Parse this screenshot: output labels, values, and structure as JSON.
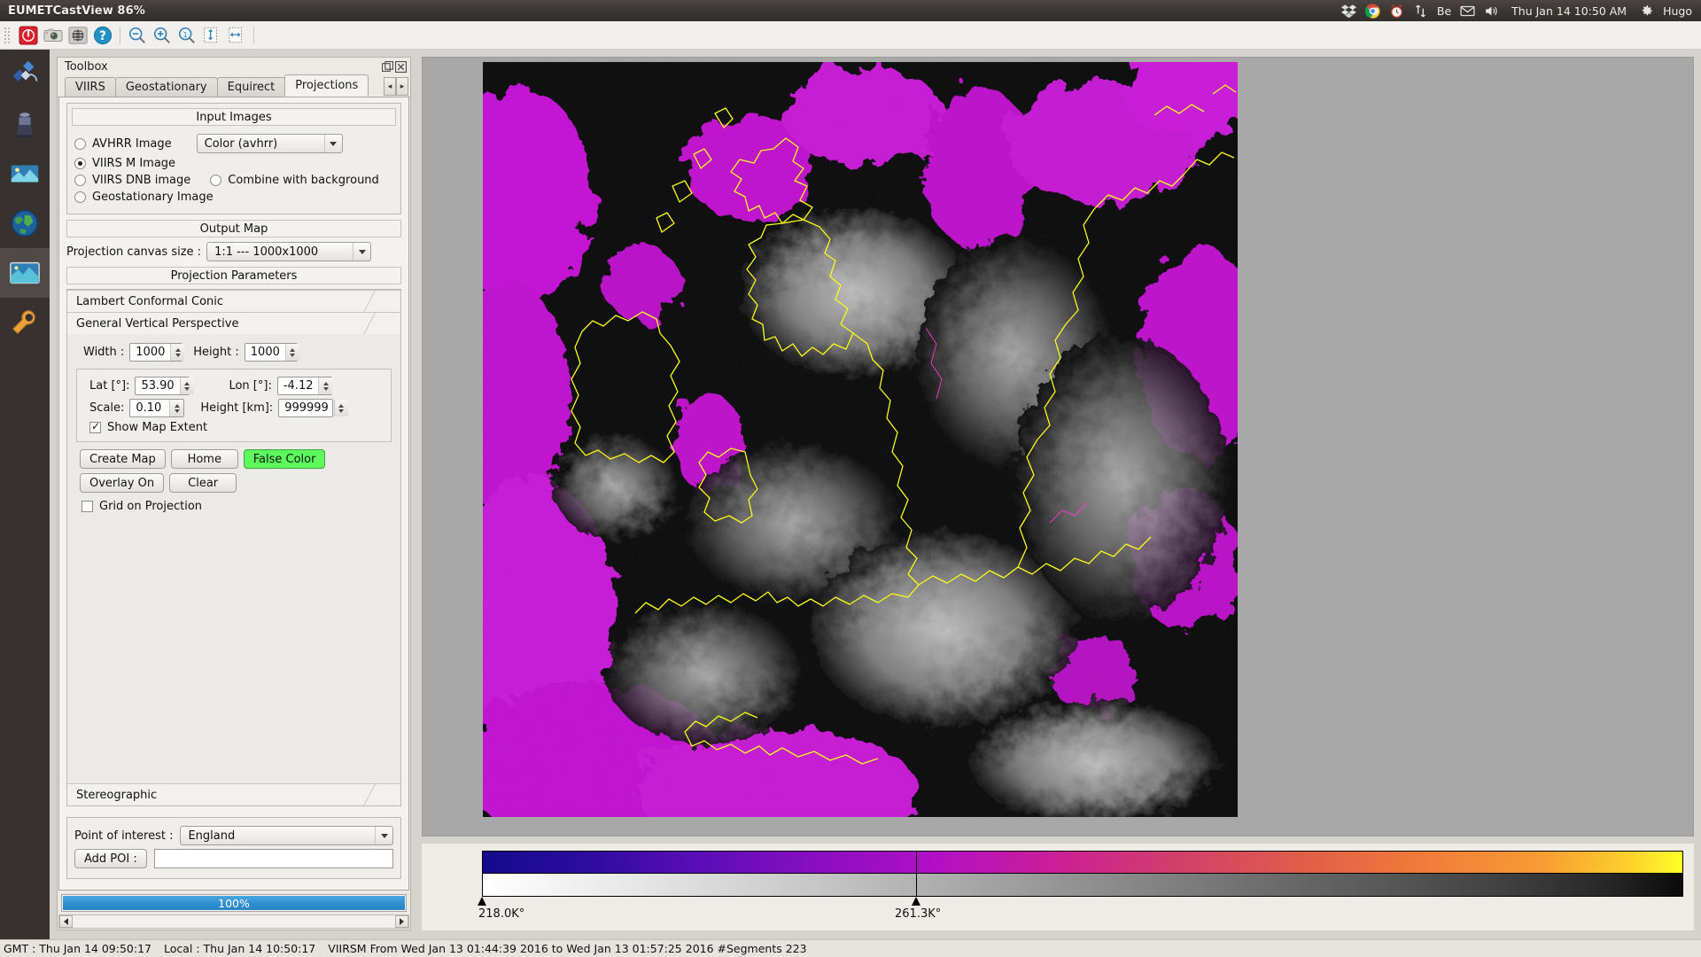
{
  "unity": {
    "app_title": "EUMETCastView 86%",
    "tray_icons": [
      "dropbox-icon",
      "chrome-icon",
      "alarm-clock-icon",
      "network-icon",
      "keyboard-layout-icon",
      "mail-icon",
      "volume-icon"
    ],
    "keyboard_layout": "Be",
    "clock": "Thu Jan 14 10:50 AM",
    "user": "Hugo",
    "gear_icon": "gear-icon"
  },
  "toolbar": {
    "buttons": [
      {
        "name": "stop-button",
        "tip": "Stop"
      },
      {
        "name": "camera-button",
        "tip": "Snapshot"
      },
      {
        "name": "globe-button",
        "tip": "Globe"
      },
      {
        "name": "help-button",
        "tip": "Help"
      },
      {
        "name": "zoom-out-button",
        "tip": "Zoom out"
      },
      {
        "name": "zoom-in-button",
        "tip": "Zoom in"
      },
      {
        "name": "zoom-reset-button",
        "tip": "Zoom 1:1"
      },
      {
        "name": "fit-height-button",
        "tip": "Fit height"
      },
      {
        "name": "fit-width-button",
        "tip": "Fit width"
      }
    ]
  },
  "launcher": {
    "items": [
      {
        "name": "launcher-satellite",
        "label": "Satellite"
      },
      {
        "name": "launcher-sensor",
        "label": "Sensor"
      },
      {
        "name": "launcher-image",
        "label": "Image"
      },
      {
        "name": "launcher-globe",
        "label": "Globe"
      },
      {
        "name": "launcher-projection",
        "label": "Projection"
      },
      {
        "name": "launcher-tools",
        "label": "Tools"
      }
    ]
  },
  "toolbox": {
    "title": "Toolbox",
    "float_button": "float-icon",
    "close_button": "close-icon",
    "tabs": [
      {
        "label": "VIIRS",
        "active": false
      },
      {
        "label": "Geostationary",
        "active": false
      },
      {
        "label": "Equirect",
        "active": false
      },
      {
        "label": "Projections",
        "active": true
      }
    ],
    "tab_prev": "◂",
    "tab_next": "▸"
  },
  "input_images": {
    "header": "Input Images",
    "options": [
      {
        "label": "AVHRR Image",
        "selected": false
      },
      {
        "label": "VIIRS M Image",
        "selected": true
      },
      {
        "label": "VIIRS DNB image",
        "selected": false
      },
      {
        "label": "Geostationary Image",
        "selected": false
      }
    ],
    "combine_label": "Combine with background",
    "combine_selected": false,
    "avhrr_color_combo": "Color  (avhrr)"
  },
  "output_map": {
    "header": "Output Map",
    "canvas_size_label": "Projection canvas size :",
    "canvas_size_value": "1:1  ---   1000x1000"
  },
  "projection_parameters": {
    "header": "Projection Parameters",
    "sections": [
      {
        "name": "Lambert Conformal Conic",
        "expanded": false
      },
      {
        "name": "General Vertical Perspective",
        "expanded": true
      },
      {
        "name": "Stereographic",
        "expanded": false
      }
    ],
    "gvp": {
      "width_label": "Width :",
      "width_value": "1000",
      "height_label": "Height :",
      "height_value": "1000",
      "lat_label": "Lat [°]:",
      "lat_value": "53.90",
      "lon_label": "Lon [°]:",
      "lon_value": "-4.12",
      "scale_label": "Scale:",
      "scale_value": "0.10",
      "height_km_label": "Height [km]:",
      "height_km_value": "999999",
      "show_map_extent_label": "Show Map Extent",
      "show_map_extent_checked": true,
      "buttons": [
        {
          "label": "Create Map",
          "name": "create-map-button",
          "style": "normal"
        },
        {
          "label": "Home",
          "name": "home-button",
          "style": "normal"
        },
        {
          "label": "False Color",
          "name": "false-color-button",
          "style": "green"
        },
        {
          "label": "Overlay On",
          "name": "overlay-on-button",
          "style": "normal"
        },
        {
          "label": "Clear",
          "name": "clear-button",
          "style": "normal"
        }
      ],
      "grid_on_projection_label": "Grid on Projection",
      "grid_on_projection_checked": false
    }
  },
  "poi": {
    "label": "Point of interest :",
    "value": "England",
    "add_button": "Add POI :",
    "add_input_value": "",
    "add_input_placeholder": ""
  },
  "progress": {
    "percent_label": "100%",
    "percent_value": 100
  },
  "colorbar": {
    "accent_green": "#5dfa5d",
    "ticks": [
      {
        "label": "218.0K°",
        "position_pct": 0.0
      },
      {
        "label": "261.3K°",
        "position_pct": 36.1
      }
    ]
  },
  "statusbar": {
    "gmt": "GMT : Thu Jan 14 09:50:17",
    "local": "Local : Thu Jan 14 10:50:17",
    "sensor_info": "VIIRSM From Wed Jan 13 01:44:39 2016 to Wed Jan 13 01:57:25 2016  #Segments 223"
  }
}
